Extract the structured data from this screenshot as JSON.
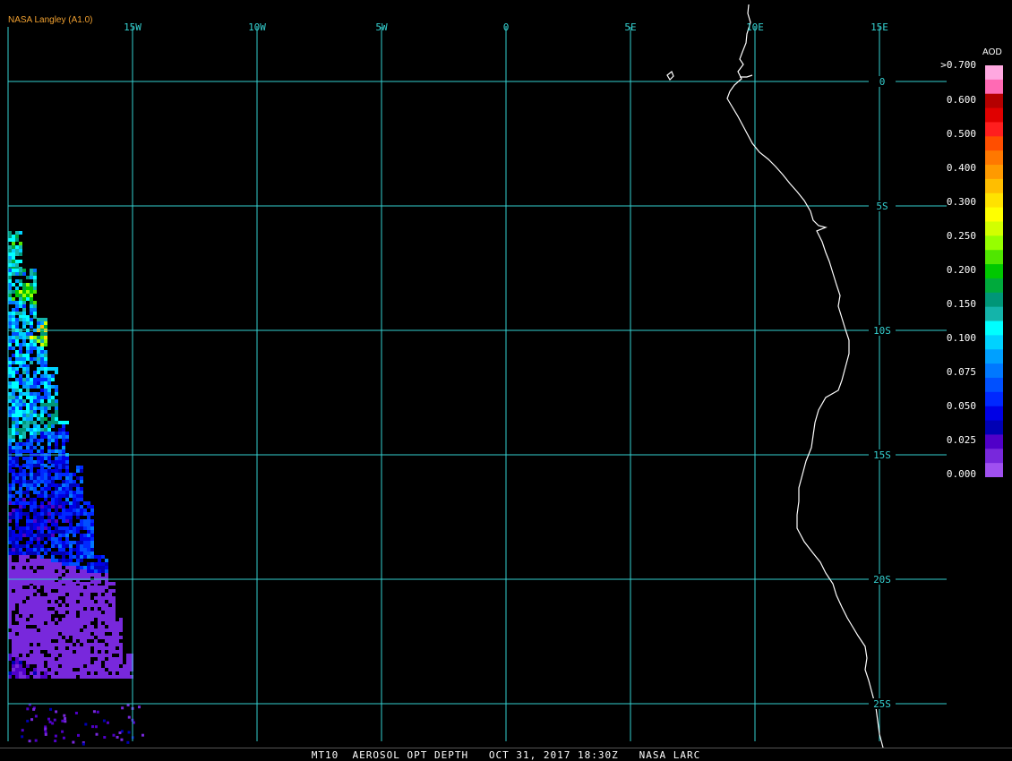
{
  "credit": "NASA Langley (A1.0)",
  "lon_ticks": [
    {
      "label": "15W",
      "lon": -15
    },
    {
      "label": "10W",
      "lon": -10
    },
    {
      "label": "5W",
      "lon": -5
    },
    {
      "label": "0",
      "lon": 0
    },
    {
      "label": "5E",
      "lon": 5
    },
    {
      "label": "10E",
      "lon": 10
    },
    {
      "label": "15E",
      "lon": 15
    }
  ],
  "lat_ticks": [
    {
      "label": "0",
      "lat": 0
    },
    {
      "label": "5S",
      "lat": -5
    },
    {
      "label": "10S",
      "lat": -10
    },
    {
      "label": "15S",
      "lat": -15
    },
    {
      "label": "20S",
      "lat": -20
    },
    {
      "label": "25S",
      "lat": -25
    }
  ],
  "legend": {
    "title": "AOD",
    "labels": [
      ">0.700",
      "0.600",
      "0.500",
      "0.400",
      "0.300",
      "0.250",
      "0.200",
      "0.150",
      "0.100",
      "0.075",
      "0.050",
      "0.025",
      "0.000"
    ],
    "colors": [
      "#ffa8e0",
      "#ff6ab4",
      "#b40000",
      "#e00000",
      "#ff1e1e",
      "#ff4e00",
      "#ff7800",
      "#ff9a00",
      "#ffbe00",
      "#ffe200",
      "#ffff00",
      "#d2ff00",
      "#96ff00",
      "#50e600",
      "#00c800",
      "#00aa3c",
      "#009678",
      "#14b4aa",
      "#00ffff",
      "#00d2ff",
      "#00a0ff",
      "#0078ff",
      "#0050ff",
      "#0028ff",
      "#0000e6",
      "#0000b4",
      "#5000c8",
      "#7828dc",
      "#a050f0"
    ]
  },
  "footer": "MT10  AEROSOL OPT DEPTH   OCT 31, 2017 18:30Z   NASA LARC",
  "colors": {
    "grid": "#35d0d0",
    "coast": "#ffffff",
    "background": "#000000",
    "credit": "#f0a030"
  },
  "aod_swath": [
    {
      "lat": -6.1,
      "lon": -19.8,
      "aod": 0.15
    },
    {
      "lat": -7.5,
      "lon": -19.5,
      "aod": 0.12
    },
    {
      "lat": -8.3,
      "lon": -18.9,
      "aod": 0.2
    },
    {
      "lat": -9.5,
      "lon": -19.2,
      "aod": 0.1
    },
    {
      "lat": -10.2,
      "lon": -18.5,
      "aod": 0.25
    },
    {
      "lat": -11.0,
      "lon": -19.0,
      "aod": 0.09
    },
    {
      "lat": -11.8,
      "lon": -18.6,
      "aod": 0.08
    },
    {
      "lat": -12.6,
      "lon": -19.4,
      "aod": 0.09
    },
    {
      "lat": -13.5,
      "lon": -18.8,
      "aod": 0.12
    },
    {
      "lat": -14.5,
      "lon": -18.4,
      "aod": 0.06
    },
    {
      "lat": -15.5,
      "lon": -18.6,
      "aod": 0.05
    },
    {
      "lat": -16.4,
      "lon": -17.8,
      "aod": 0.05
    },
    {
      "lat": -17.4,
      "lon": -18.2,
      "aod": 0.04
    },
    {
      "lat": -18.5,
      "lon": -17.5,
      "aod": 0.05
    },
    {
      "lat": -20.2,
      "lon": -18.0,
      "aod": 0.01
    },
    {
      "lat": -21.3,
      "lon": -17.0,
      "aod": 0.01
    },
    {
      "lat": -22.5,
      "lon": -16.6,
      "aod": 0.01
    },
    {
      "lat": -26.0,
      "lon": -18.5,
      "aod": 0.02
    }
  ]
}
